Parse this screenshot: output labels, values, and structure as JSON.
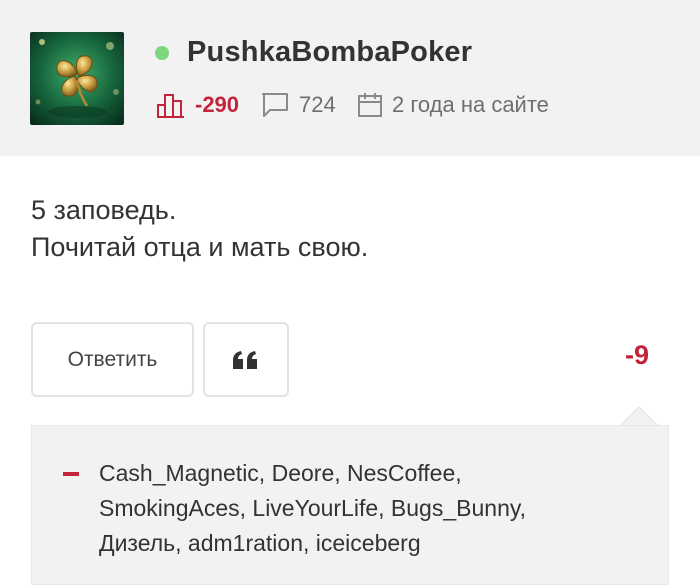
{
  "user": {
    "name": "PushkaBombaPoker",
    "rating": "-290",
    "comments": "724",
    "site_age": "2 года на сайте",
    "online_color": "#7dd77d"
  },
  "comment": {
    "lines": [
      "5 заповедь.",
      "Почитай отца и мать свою."
    ]
  },
  "actions": {
    "reply_label": "Ответить",
    "quote_icon": "quote-icon",
    "score": "-9"
  },
  "voters": {
    "sign_icon": "minus-icon",
    "lines": [
      "Cash_Magnetic, Deore, NesCoffee,",
      "SmokingAces, LiveYourLife, Bugs_Bunny,",
      "Дизель, adm1ration, iceiceberg"
    ]
  },
  "colors": {
    "accent_red": "#c4243b",
    "header_bg": "#f2f2f2",
    "text": "#333333",
    "muted": "#6e6e6e"
  }
}
